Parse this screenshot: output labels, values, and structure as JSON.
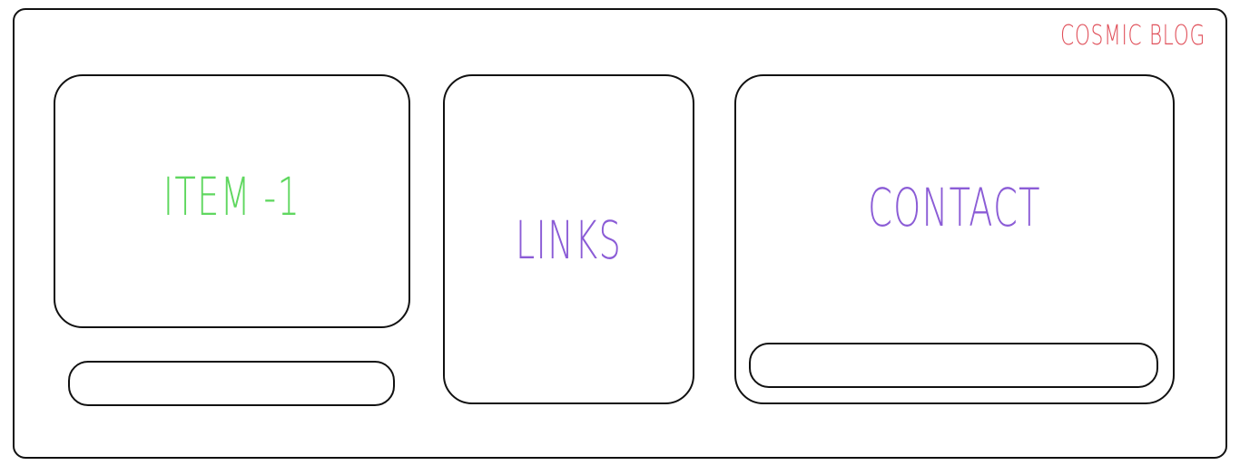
{
  "header": {
    "brand": "COSMIC BLOG"
  },
  "cards": {
    "item": {
      "label": "ITEM -1",
      "color": "#5fd75f"
    },
    "links": {
      "label": "LINKS",
      "color": "#8b5cd6"
    },
    "contact": {
      "label": "CONTACT",
      "color": "#8b5cd6"
    }
  },
  "colors": {
    "brand": "#e0505a",
    "border": "#111111",
    "background": "#ffffff"
  }
}
